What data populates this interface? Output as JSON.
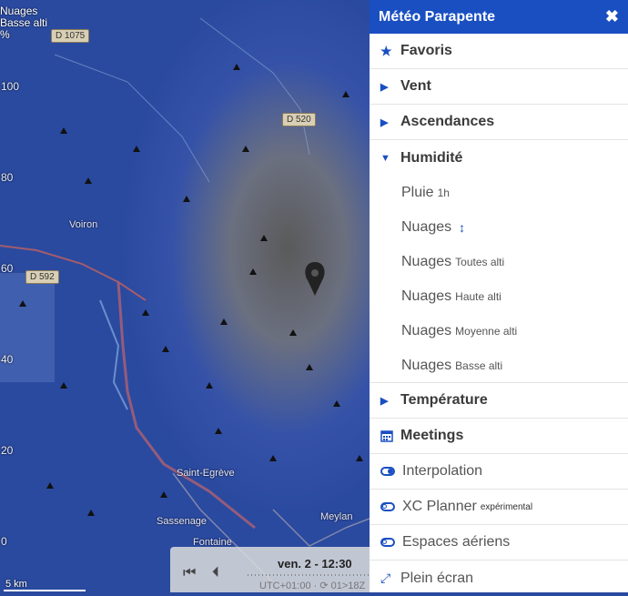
{
  "map": {
    "legend_line1": "Nuages",
    "legend_line2": "Basse alti",
    "legend_line3": "%",
    "scale_labels": [
      "100",
      "80",
      "60",
      "40",
      "20",
      "0"
    ],
    "roads": [
      "D 1075",
      "D 520",
      "D 592"
    ],
    "places": [
      "Voiron",
      "Saint-Egrève",
      "Sassenage",
      "Fontaine",
      "Meylan"
    ],
    "scale_text": "5 km"
  },
  "timebar": {
    "date": "ven. 2 - 12:30",
    "sub": "UTC+01:00 · ⟳ 01>18Z"
  },
  "panel": {
    "title": "Météo Parapente",
    "close": "✖",
    "items": [
      {
        "label": "Favoris"
      },
      {
        "label": "Vent"
      },
      {
        "label": "Ascendances"
      },
      {
        "label": "Humidité"
      },
      {
        "label": "Pluie",
        "small": "1h"
      },
      {
        "label": "Nuages",
        "small": "↕"
      },
      {
        "label": "Nuages",
        "small": "Toutes alti"
      },
      {
        "label": "Nuages",
        "small": "Haute alti"
      },
      {
        "label": "Nuages",
        "small": "Moyenne alti"
      },
      {
        "label": "Nuages",
        "small": "Basse alti"
      },
      {
        "label": "Température"
      },
      {
        "label": "Meetings"
      },
      {
        "label": "Interpolation"
      },
      {
        "label": "XC Planner",
        "sup": "expérimental"
      },
      {
        "label": "Espaces aériens"
      },
      {
        "label": "Plein écran"
      }
    ]
  }
}
